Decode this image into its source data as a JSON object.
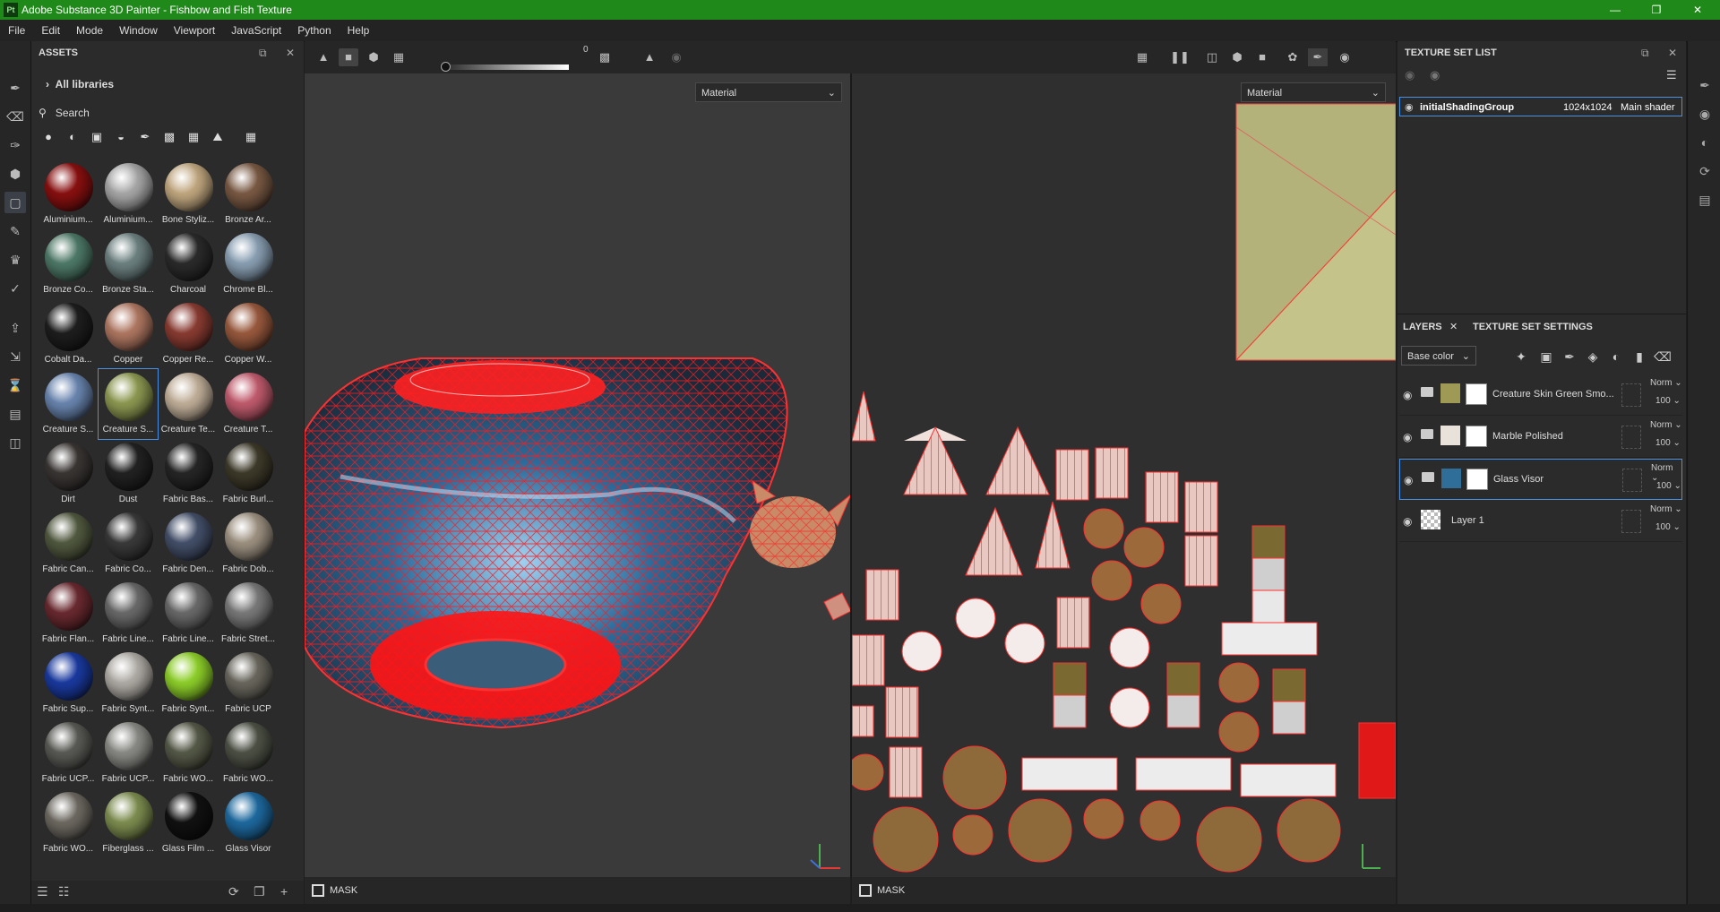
{
  "window": {
    "title": "Adobe Substance 3D Painter - Fishbow and Fish Texture",
    "app_icon": "Pt",
    "controls": [
      "minimize-icon",
      "maximize-icon",
      "close-icon"
    ]
  },
  "menu": [
    "File",
    "Edit",
    "Mode",
    "Window",
    "Viewport",
    "JavaScript",
    "Python",
    "Help"
  ],
  "left_tools": [
    "paint-brush-icon",
    "eraser-icon",
    "projection-icon",
    "geometry-mask-icon",
    "polygon-fill-icon",
    "smudge-icon",
    "clone-icon",
    "color-picker-icon",
    "bake-icon",
    "export-icon",
    "iray-icon",
    "display-settings-icon",
    "shelf-icon"
  ],
  "assets": {
    "title": "ASSETS",
    "libraries": "All libraries",
    "search_placeholder": "Search",
    "filter_icons": [
      "materials-filter-icon",
      "smart-materials-filter-icon",
      "masks-filter-icon",
      "smart-masks-filter-icon",
      "brushes-filter-icon",
      "procedurals-filter-icon",
      "textures-filter-icon",
      "environments-filter-icon",
      "grid-view-icon"
    ],
    "items": [
      {
        "label": "Aluminium...",
        "color": "#8a1010"
      },
      {
        "label": "Aluminium...",
        "color": "#a8a8a8"
      },
      {
        "label": "Bone Styliz...",
        "color": "#c2a880"
      },
      {
        "label": "Bronze Ar...",
        "color": "#7a5a44"
      },
      {
        "label": "Bronze Co...",
        "color": "#4e7a68"
      },
      {
        "label": "Bronze Sta...",
        "color": "#6e8282"
      },
      {
        "label": "Charcoal",
        "color": "#2b2b2b"
      },
      {
        "label": "Chrome Bl...",
        "color": "#8aa0b4"
      },
      {
        "label": "Cobalt Da...",
        "color": "#1e1e1e"
      },
      {
        "label": "Copper",
        "color": "#b07862"
      },
      {
        "label": "Copper Re...",
        "color": "#8a3c32"
      },
      {
        "label": "Copper W...",
        "color": "#9a5a3e"
      },
      {
        "label": "Creature S...",
        "color": "#6a86b0"
      },
      {
        "label": "Creature S...",
        "color": "#8e9a52"
      },
      {
        "label": "Creature Te...",
        "color": "#c2b09a"
      },
      {
        "label": "Creature T...",
        "color": "#c25c6e"
      },
      {
        "label": "Dirt",
        "color": "#3a3634"
      },
      {
        "label": "Dust",
        "color": "#222222"
      },
      {
        "label": "Fabric Bas...",
        "color": "#262626"
      },
      {
        "label": "Fabric Burl...",
        "color": "#3e3a2a"
      },
      {
        "label": "Fabric Can...",
        "color": "#525a40"
      },
      {
        "label": "Fabric Co...",
        "color": "#3a3a3a"
      },
      {
        "label": "Fabric Den...",
        "color": "#44506a"
      },
      {
        "label": "Fabric Dob...",
        "color": "#9e9282"
      },
      {
        "label": "Fabric Flan...",
        "color": "#6a2a30"
      },
      {
        "label": "Fabric Line...",
        "color": "#6a6a6a"
      },
      {
        "label": "Fabric Line...",
        "color": "#6a6a6a"
      },
      {
        "label": "Fabric Stret...",
        "color": "#7a7a7a"
      },
      {
        "label": "Fabric Sup...",
        "color": "#1a3aa0"
      },
      {
        "label": "Fabric Synt...",
        "color": "#b0aca6"
      },
      {
        "label": "Fabric Synt...",
        "color": "#8ed02a"
      },
      {
        "label": "Fabric UCP",
        "color": "#6a685e"
      },
      {
        "label": "Fabric UCP...",
        "color": "#5a5a56"
      },
      {
        "label": "Fabric UCP...",
        "color": "#8a8a86"
      },
      {
        "label": "Fabric WO...",
        "color": "#565a48"
      },
      {
        "label": "Fabric WO...",
        "color": "#4e5246"
      },
      {
        "label": "Fabric WO...",
        "color": "#6e6a62"
      },
      {
        "label": "Fiberglass ...",
        "color": "#7e8e50"
      },
      {
        "label": "Glass Film ...",
        "color": "#111111"
      },
      {
        "label": "Glass Visor",
        "color": "#1e6aa0"
      }
    ],
    "selected_index": 13,
    "footer_icons": [
      "import-icon",
      "list-view-icon",
      "refresh-icon",
      "new-window-icon",
      "add-icon"
    ]
  },
  "viewport_toolbar": {
    "left_icons": [
      "triangle-mode-icon",
      "square-mode-icon",
      "cube-mode-icon",
      "checker-icon"
    ],
    "slider_value": "0",
    "right_left_icons": [
      "symmetry-icon",
      "mirror-icon"
    ],
    "right_icons": [
      "hide-icon",
      "pause-icon",
      "split-icon",
      "object-icon",
      "camera-icon",
      "settings-icon",
      "brush-active-icon",
      "screenshot-icon"
    ]
  },
  "viewport_3d": {
    "dropdown": "Material",
    "mask_label": "MASK"
  },
  "viewport_2d": {
    "dropdown": "Material",
    "mask_label": "MASK"
  },
  "texture_set_list": {
    "title": "TEXTURE SET LIST",
    "row": {
      "name": "initialShadingGroup",
      "resolution": "1024x1024",
      "shader": "Main shader"
    }
  },
  "layers_panel": {
    "tabs": [
      "LAYERS",
      "TEXTURE SET SETTINGS"
    ],
    "channel": "Base color",
    "toolbar_icons": [
      "add-effect-icon",
      "add-mask-icon",
      "paint-layer-icon",
      "fill-layer-icon",
      "smart-material-icon",
      "folder-icon",
      "delete-icon"
    ],
    "layers": [
      {
        "name": "Creature Skin Green Smo...",
        "blend": "Norm",
        "opacity": "100",
        "color": "#9e9a56",
        "selected": false
      },
      {
        "name": "Marble Polished",
        "blend": "Norm",
        "opacity": "100",
        "color": "#e8e2da",
        "selected": false
      },
      {
        "name": "Glass Visor",
        "blend": "Norm",
        "opacity": "100",
        "color": "#2e6e98",
        "selected": true
      },
      {
        "name": "Layer 1",
        "blend": "Norm",
        "opacity": "100",
        "color": "checker",
        "selected": false
      }
    ]
  },
  "right_strip_icons": [
    "notification-icon",
    "camera-settings-icon",
    "shader-icon",
    "history-icon",
    "log-icon"
  ]
}
